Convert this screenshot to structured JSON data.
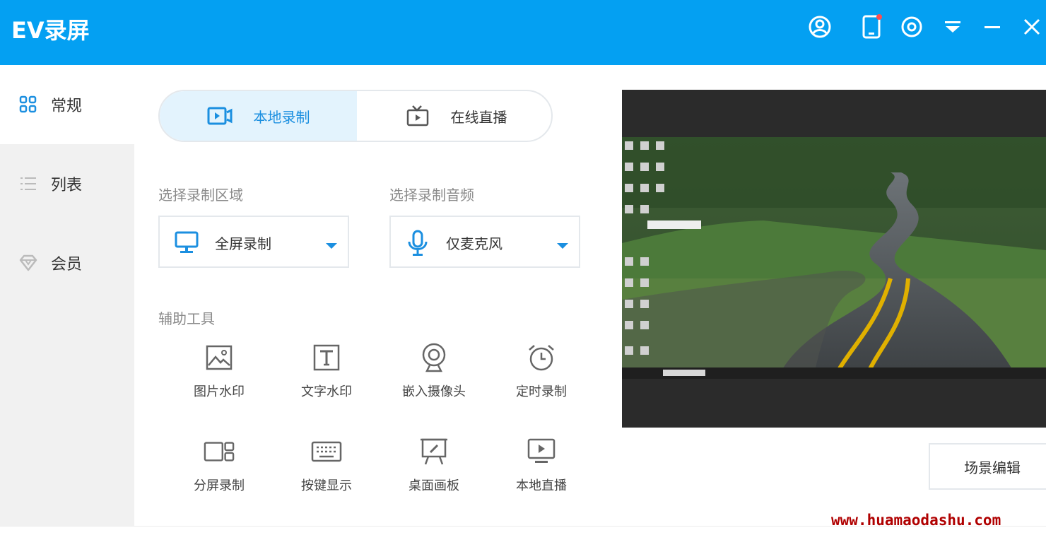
{
  "app": {
    "title": "EV录屏"
  },
  "colors": {
    "titlebar": "#04a0f2",
    "accent": "#1b8fe0",
    "active_tab_bg": "#e3f3fd",
    "sidebar_bg": "#f1f1f1",
    "watermark": "#b00000"
  },
  "titlebar_buttons": [
    "user-icon",
    "phone-icon",
    "settings-icon",
    "dropdown-icon",
    "minimize-icon",
    "close-icon"
  ],
  "sidebar": {
    "items": [
      {
        "label": "常规",
        "icon": "grid-icon",
        "active": true
      },
      {
        "label": "列表",
        "icon": "list-icon",
        "active": false
      },
      {
        "label": "会员",
        "icon": "diamond-icon",
        "active": false
      }
    ]
  },
  "mode_tabs": [
    {
      "label": "本地录制",
      "icon": "local-record-icon",
      "active": true
    },
    {
      "label": "在线直播",
      "icon": "live-tv-icon",
      "active": false
    }
  ],
  "record_area": {
    "label": "选择录制区域",
    "value": "全屏录制",
    "icon": "monitor-icon"
  },
  "record_audio": {
    "label": "选择录制音频",
    "value": "仅麦克风",
    "icon": "microphone-icon"
  },
  "tools": {
    "label": "辅助工具",
    "items": [
      {
        "label": "图片水印",
        "icon": "image-icon"
      },
      {
        "label": "文字水印",
        "icon": "text-icon"
      },
      {
        "label": "嵌入摄像头",
        "icon": "webcam-icon"
      },
      {
        "label": "定时录制",
        "icon": "alarm-clock-icon"
      },
      {
        "label": "分屏录制",
        "icon": "split-screen-icon"
      },
      {
        "label": "按键显示",
        "icon": "keyboard-icon"
      },
      {
        "label": "桌面画板",
        "icon": "whiteboard-icon"
      },
      {
        "label": "本地直播",
        "icon": "local-live-icon"
      }
    ]
  },
  "preview": {
    "scene_button": "场景编辑"
  },
  "watermark": "www.huamaodashu.com"
}
